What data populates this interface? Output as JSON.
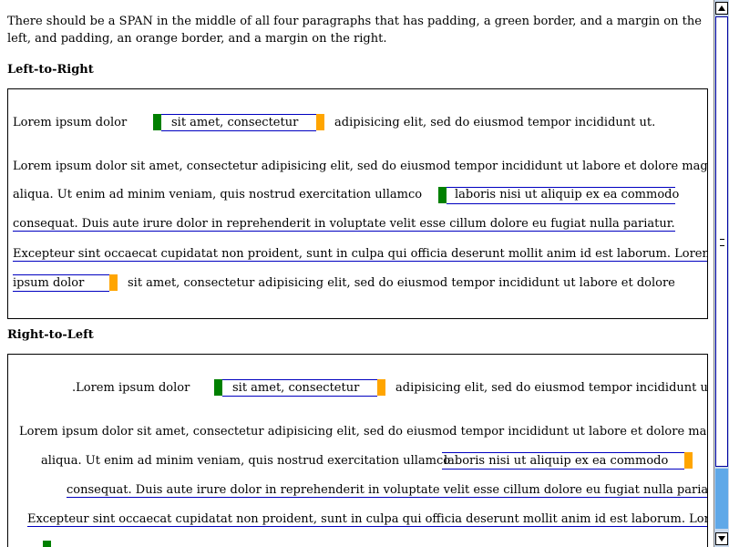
{
  "intro": "There should be a SPAN in the middle of all four paragraphs that has padding, a green border, and a margin on the left, and padding, an orange border, and a margin on the right.",
  "sections": {
    "ltr": {
      "heading": "Left-to-Right",
      "p1": {
        "before": "Lorem ipsum dolor",
        "span": "sit amet, consectetur",
        "after": "adipisicing elit, sed do eiusmod tempor incididunt ut."
      },
      "p2": {
        "l1": "Lorem ipsum dolor sit amet, consectetur adipisicing elit, sed do eiusmod tempor incididunt ut labore et dolore magna",
        "l2_before": "aliqua. Ut enim ad minim veniam, quis nostrud exercitation ullamco",
        "l2_span": "laboris nisi ut aliquip ex ea commodo",
        "l3": "consequat. Duis aute irure dolor in reprehenderit in voluptate velit esse cillum dolore eu fugiat nulla pariatur.",
        "l4": "Excepteur sint occaecat cupidatat non proident, sunt in culpa qui officia deserunt mollit anim id est laborum. Lorem",
        "l5_span": "ipsum dolor",
        "l5_after": "sit amet, consectetur adipisicing elit, sed do eiusmod tempor incididunt ut labore et dolore"
      }
    },
    "rtl": {
      "heading": "Right-to-Left",
      "p1": {
        "before": ".Lorem ipsum dolor",
        "span": "sit amet, consectetur",
        "after": "adipisicing elit, sed do eiusmod tempor incididunt ut"
      },
      "p2": {
        "l1": "Lorem ipsum dolor sit amet, consectetur adipisicing elit, sed do eiusmod tempor incididunt ut labore et dolore magna",
        "l2_before": "aliqua. Ut enim ad minim veniam, quis nostrud exercitation ullamco",
        "l2_span": "laboris nisi ut aliquip ex ea commodo",
        "l3": "consequat. Duis aute irure dolor in reprehenderit in voluptate velit esse cillum dolore eu fugiat nulla pariatur.",
        "l4": "Excepteur sint occaecat cupidatat non proident, sunt in culpa qui officia deserunt mollit anim id est laborum. Lorem"
      }
    }
  },
  "scrollbar": {
    "up_icon": "arrow-up-icon",
    "down_icon": "arrow-down-icon"
  }
}
